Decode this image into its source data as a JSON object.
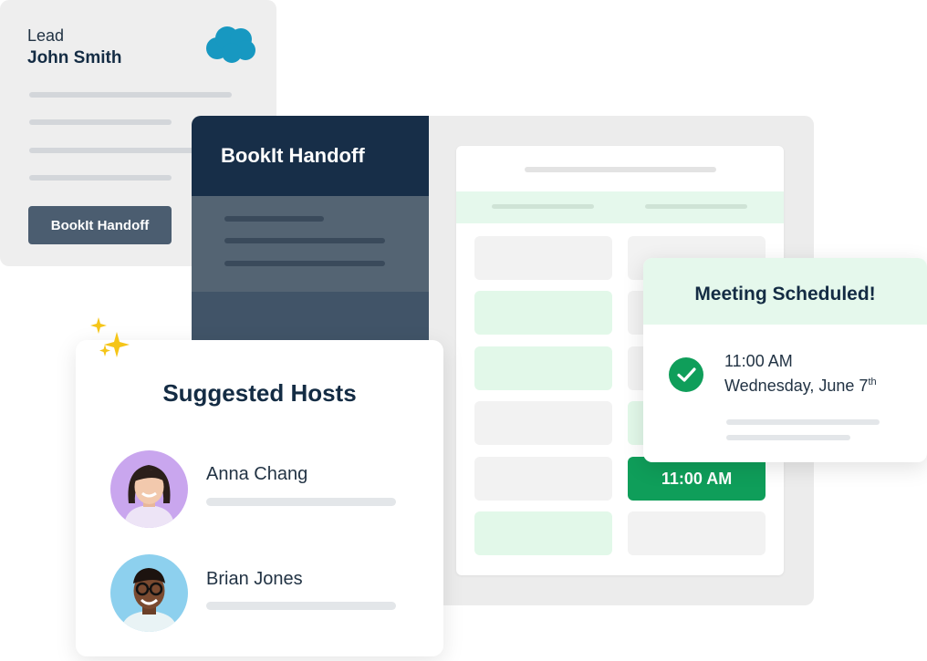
{
  "lead_card": {
    "label": "Lead",
    "name": "John Smith",
    "button_label": "BookIt Handoff",
    "logo_icon": "salesforce-cloud-icon"
  },
  "handoff_panel": {
    "title": "BookIt Handoff"
  },
  "calendar": {
    "selected_slot": "11:00 AM"
  },
  "suggested_hosts": {
    "title": "Suggested Hosts",
    "hosts": [
      {
        "name": "Anna Chang"
      },
      {
        "name": "Brian Jones"
      }
    ]
  },
  "meeting_card": {
    "title": "Meeting Scheduled!",
    "time": "11:00 AM",
    "date": "Wednesday, June 7",
    "date_suffix": "th"
  },
  "colors": {
    "navy": "#172e48",
    "green": "#0f9e5a",
    "mint": "#e5f8ec",
    "salesforce_blue": "#1798c1"
  }
}
